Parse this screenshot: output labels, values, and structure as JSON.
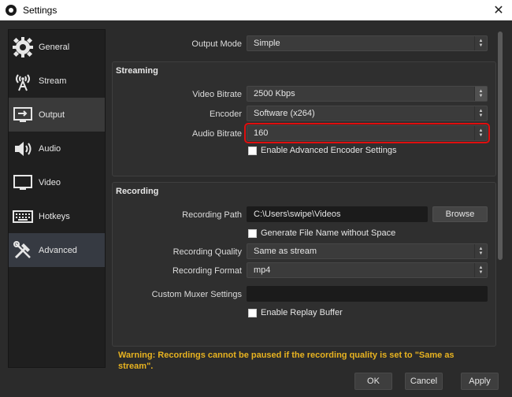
{
  "window": {
    "title": "Settings"
  },
  "sidebar": {
    "items": [
      {
        "label": "General",
        "icon": "gear-icon"
      },
      {
        "label": "Stream",
        "icon": "broadcast-icon"
      },
      {
        "label": "Output",
        "icon": "output-monitor-icon"
      },
      {
        "label": "Audio",
        "icon": "speaker-icon"
      },
      {
        "label": "Video",
        "icon": "monitor-icon"
      },
      {
        "label": "Hotkeys",
        "icon": "keyboard-icon"
      },
      {
        "label": "Advanced",
        "icon": "tools-icon"
      }
    ],
    "active": "Output"
  },
  "output_mode": {
    "label": "Output Mode",
    "value": "Simple"
  },
  "streaming": {
    "title": "Streaming",
    "video_bitrate": {
      "label": "Video Bitrate",
      "value": "2500 Kbps"
    },
    "encoder": {
      "label": "Encoder",
      "value": "Software (x264)"
    },
    "audio_bitrate": {
      "label": "Audio Bitrate",
      "value": "160"
    },
    "advanced_encoder": {
      "label": "Enable Advanced Encoder Settings",
      "checked": false
    }
  },
  "recording": {
    "title": "Recording",
    "path": {
      "label": "Recording Path",
      "value": "C:\\Users\\swipe\\Videos"
    },
    "browse_label": "Browse",
    "filename_no_space": {
      "label": "Generate File Name without Space",
      "checked": false
    },
    "quality": {
      "label": "Recording Quality",
      "value": "Same as stream"
    },
    "format": {
      "label": "Recording Format",
      "value": "mp4"
    },
    "muxer": {
      "label": "Custom Muxer Settings",
      "value": ""
    },
    "replay_buffer": {
      "label": "Enable Replay Buffer",
      "checked": false
    }
  },
  "warning": "Warning: Recordings cannot be paused if the recording quality is set to \"Same as stream\".",
  "footer": {
    "ok": "OK",
    "cancel": "Cancel",
    "apply": "Apply"
  },
  "colors": {
    "accent_highlight": "#e00e0e",
    "warning": "#e8b320"
  }
}
